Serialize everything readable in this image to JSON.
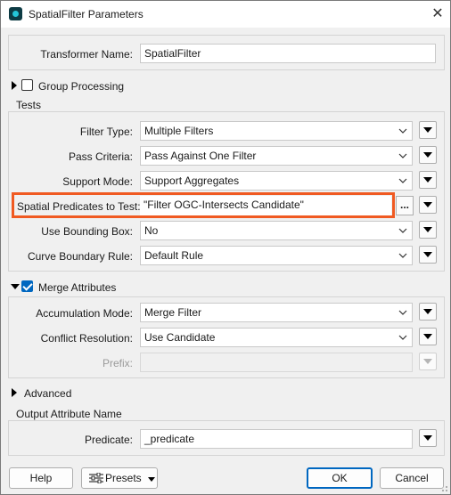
{
  "window": {
    "title": "SpatialFilter Parameters"
  },
  "transformer_name": {
    "label": "Transformer Name:",
    "value": "SpatialFilter"
  },
  "group_processing": {
    "label": "Group Processing",
    "checked": false
  },
  "tests": {
    "section_label": "Tests",
    "filter_type": {
      "label": "Filter Type:",
      "value": "Multiple Filters"
    },
    "pass_criteria": {
      "label": "Pass Criteria:",
      "value": "Pass Against One Filter"
    },
    "support_mode": {
      "label": "Support Mode:",
      "value": "Support Aggregates"
    },
    "spatial_predicates": {
      "label": "Spatial Predicates to Test:",
      "value": "\"Filter OGC-Intersects Candidate\"",
      "button": "..."
    },
    "use_bounding_box": {
      "label": "Use Bounding Box:",
      "value": "No"
    },
    "curve_boundary_rule": {
      "label": "Curve Boundary Rule:",
      "value": "Default Rule"
    }
  },
  "merge_attributes": {
    "label": "Merge Attributes",
    "checked": true,
    "accumulation_mode": {
      "label": "Accumulation Mode:",
      "value": "Merge Filter"
    },
    "conflict_resolution": {
      "label": "Conflict Resolution:",
      "value": "Use Candidate"
    },
    "prefix": {
      "label": "Prefix:",
      "value": ""
    }
  },
  "advanced": {
    "label": "Advanced"
  },
  "output": {
    "section_label": "Output Attribute Name",
    "predicate": {
      "label": "Predicate:",
      "value": "_predicate"
    }
  },
  "footer": {
    "help": "Help",
    "presets": "Presets",
    "ok": "OK",
    "cancel": "Cancel"
  },
  "colors": {
    "highlight": "#f05a22",
    "accent": "#0067c0"
  }
}
